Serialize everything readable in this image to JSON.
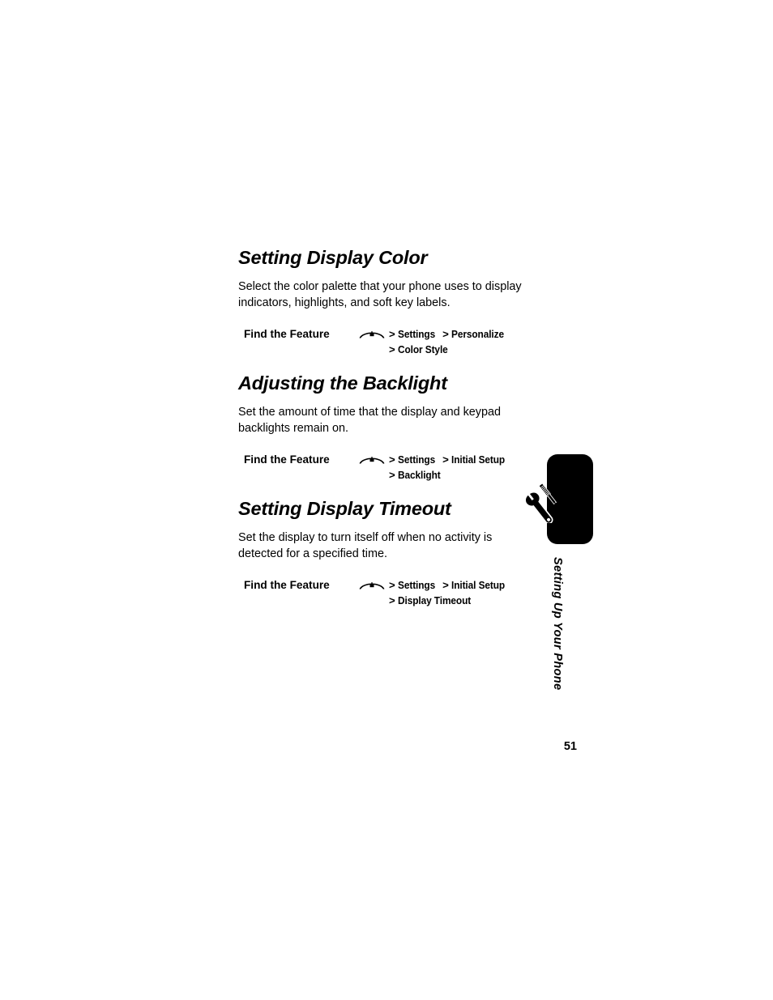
{
  "page": {
    "number": "51",
    "chapter_tab_label": "Setting Up Your Phone",
    "chapter_tab_icon": "wrench-screwdriver-icon"
  },
  "feature_label": "Find the Feature",
  "menu_key_icon": "menu-key-icon",
  "separator": ">",
  "sections": [
    {
      "heading": "Setting Display Color",
      "body": "Select the color palette that your phone uses to display indicators, highlights, and soft key labels.",
      "find_the_feature": {
        "label": "Find the Feature",
        "key_icon": "menu-key-icon",
        "path_line1": [
          "Settings",
          "Personalize"
        ],
        "path_line2": [
          "Color Style"
        ]
      }
    },
    {
      "heading": "Adjusting the Backlight",
      "body": "Set the amount of time that the display and keypad backlights remain on.",
      "find_the_feature": {
        "label": "Find the Feature",
        "key_icon": "menu-key-icon",
        "path_line1": [
          "Settings",
          "Initial Setup"
        ],
        "path_line2": [
          "Backlight"
        ]
      }
    },
    {
      "heading": "Setting Display Timeout",
      "body": "Set the display to turn itself off when no activity is detected for a specified time.",
      "find_the_feature": {
        "label": "Find the Feature",
        "key_icon": "menu-key-icon",
        "path_line1": [
          "Settings",
          "Initial Setup"
        ],
        "path_line2": [
          "Display Timeout"
        ]
      }
    }
  ],
  "colors": {
    "ink": "#000000",
    "paper": "#ffffff",
    "tab": "#000000"
  }
}
